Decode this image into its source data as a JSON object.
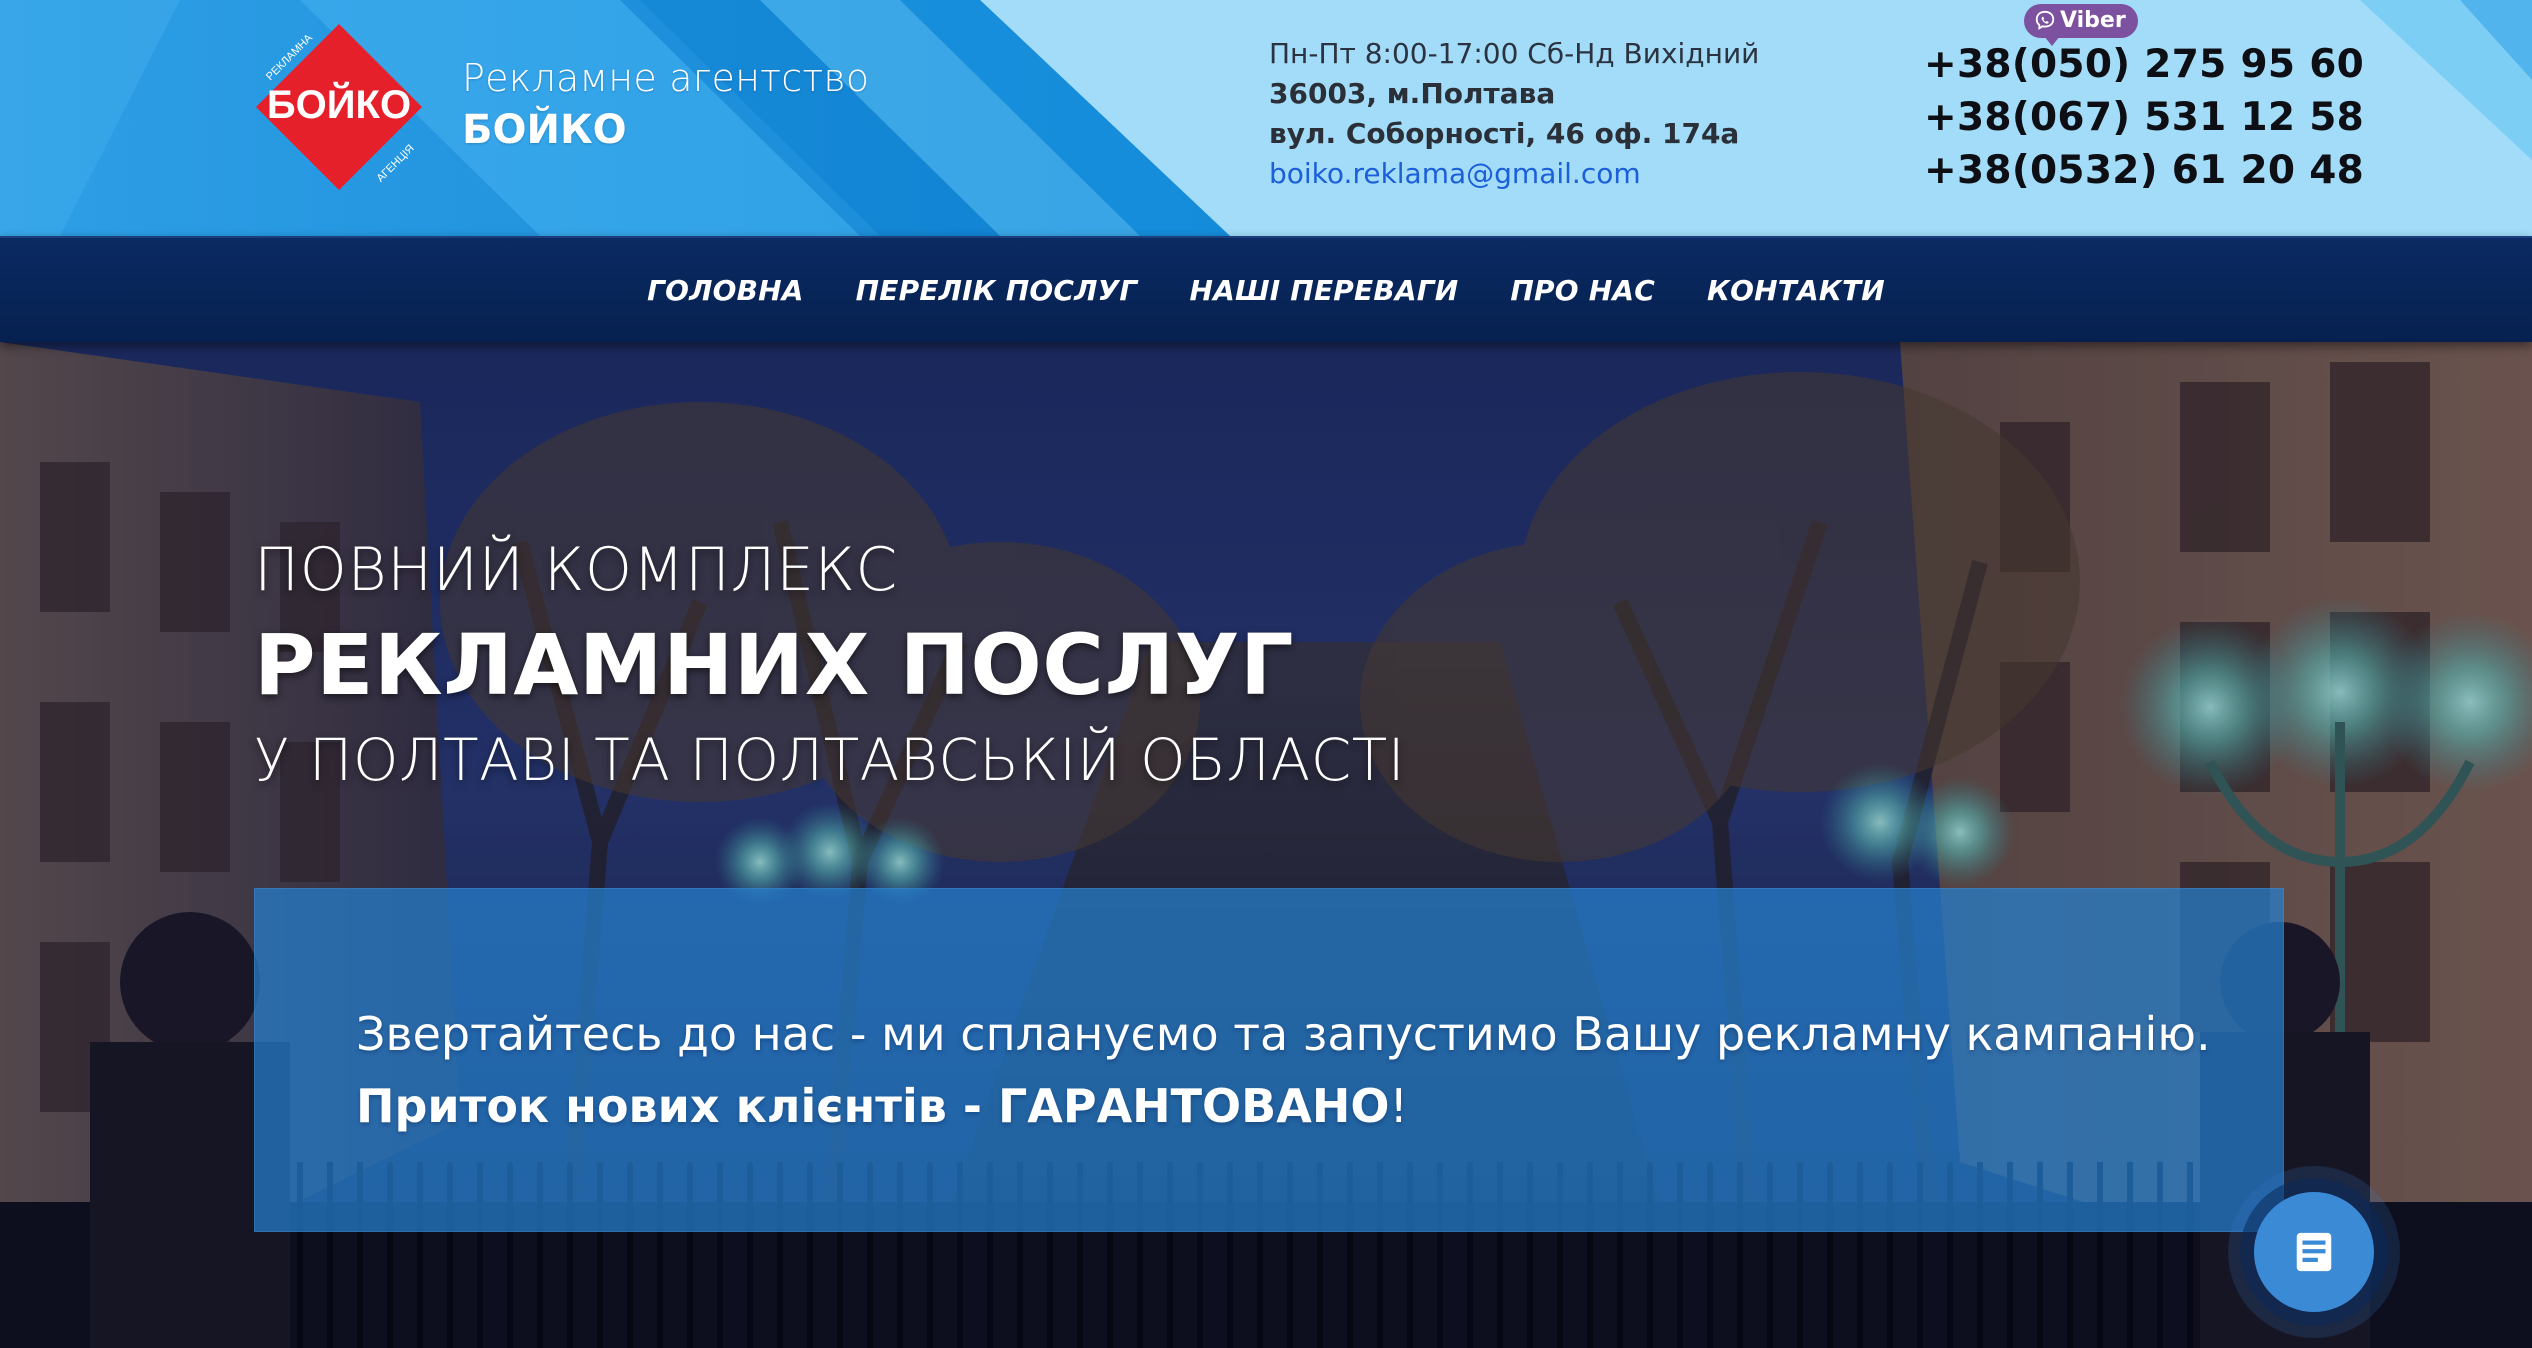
{
  "header": {
    "brand_sub": "Рекламне агентство",
    "brand_name": "БОЙКО",
    "logo": {
      "main_text": "БОЙКО",
      "top_text": "РЕКЛАМНА",
      "bottom_text": "АГЕНЦІЯ",
      "color": "#e5202a"
    },
    "hours": "Пн-Пт 8:00-17:00 Сб-Нд Вихідний",
    "city": "36003, м.Полтава",
    "street": "вул. Соборності, 46 оф. 174а",
    "email": "boiko.reklama@gmail.com",
    "viber_label": "Viber",
    "phones": [
      "+38(050) 275 95 60",
      "+38(067) 531 12 58",
      "+38(0532) 61 20 48"
    ]
  },
  "nav": {
    "items": [
      {
        "label": "ГОЛОВНА"
      },
      {
        "label": "ПЕРЕЛІК ПОСЛУГ"
      },
      {
        "label": "НАШІ ПЕРЕВАГИ"
      },
      {
        "label": "ПРО НАС"
      },
      {
        "label": "КОНТАКТИ"
      }
    ]
  },
  "hero": {
    "line1": "ПОВНИЙ КОМПЛЕКС",
    "line2": "РЕКЛАМНИХ ПОСЛУГ",
    "line3": "У ПОЛТАВІ ТА ПОЛТАВСЬКІЙ ОБЛАСТІ",
    "cta_line1": "Звертайтесь до нас - ми сплануємо та запустимо Вашу рекламну кампанію.",
    "cta_line2": "Приток нових клієнтів - ГАРАНТОВАНО",
    "cta_excl": "!"
  },
  "colors": {
    "header_light": "#a3dcf8",
    "header_blue": "#1e90d8",
    "nav_bg": "#0b2a63",
    "cta_bg": "#2680ce",
    "email": "#1b5fd9",
    "viber": "#7c519f"
  },
  "chat_widget": {
    "icon": "chat-icon"
  }
}
